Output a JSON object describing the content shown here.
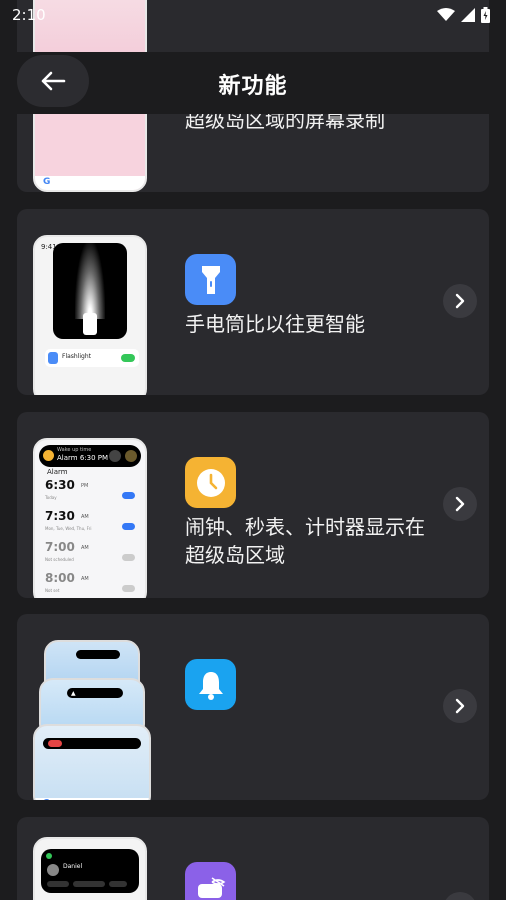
{
  "status_bar": {
    "time": "2:10"
  },
  "header": {
    "title": "新功能"
  },
  "features": [
    {
      "text": "超级岛区域的屏幕录制"
    },
    {
      "text": "手电筒比以往更智能",
      "thumb": {
        "time": "9:41",
        "label": "Flashlight"
      }
    },
    {
      "text": "闹钟、秒表、计时器显示在超级岛区域",
      "thumb": {
        "pill_title": "Wake up time",
        "pill_value": "Alarm 6:30 PM",
        "heading": "Alarm",
        "alarms": [
          {
            "time": "6:30",
            "ampm": "PM",
            "sub": "Today",
            "on": true
          },
          {
            "time": "7:30",
            "ampm": "AM",
            "sub": "Mon, Tue, Wed, Thu, Fri",
            "on": true
          },
          {
            "time": "7:00",
            "ampm": "AM",
            "sub": "Not scheduled",
            "on": false
          },
          {
            "time": "8:00",
            "ampm": "AM",
            "sub": "Not set",
            "on": false
          }
        ]
      }
    },
    {
      "text": ""
    },
    {
      "text": "",
      "thumb": {
        "name": "Daniel"
      }
    }
  ],
  "icon_colors": {
    "flashlight": "#4a8cf7",
    "alarm": "#f5b333",
    "notification": "#1aa3f0",
    "privacy": "#8b61e8"
  }
}
